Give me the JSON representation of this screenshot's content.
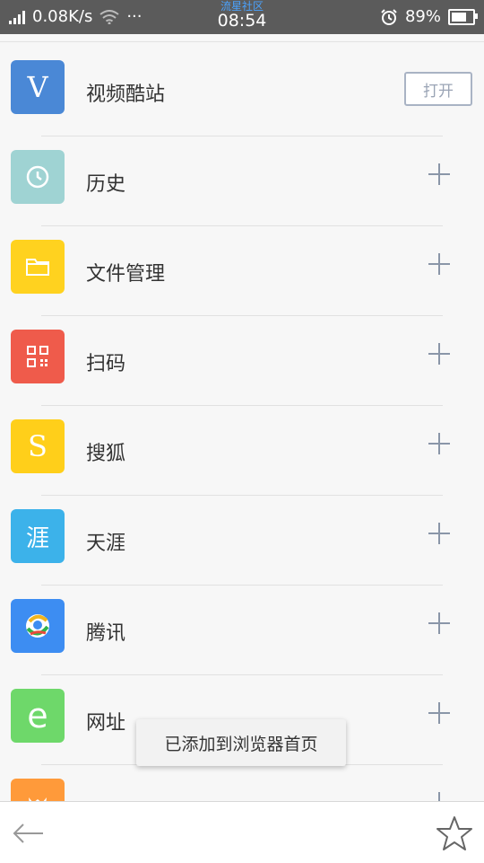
{
  "status_bar": {
    "net_speed": "0.08K/s",
    "more": "···",
    "carrier_label": "流星社区",
    "time": "08:54",
    "battery": "89%",
    "battery_level": 0.89
  },
  "items": [
    {
      "label": "视频酷站",
      "icon": "video-site-icon",
      "icon_text": "V",
      "color": "#4a88d6",
      "action": "打开"
    },
    {
      "label": "历史",
      "icon": "clock-icon",
      "color": "#9fd3d3"
    },
    {
      "label": "文件管理",
      "icon": "folder-icon",
      "color": "#ffd21f"
    },
    {
      "label": "扫码",
      "icon": "qr-code-icon",
      "color": "#ef5b4b"
    },
    {
      "label": "搜狐",
      "icon": "sohu-icon",
      "icon_text": "S",
      "color": "#ffcf1a"
    },
    {
      "label": "天涯",
      "icon": "tianya-icon",
      "icon_text": "涯",
      "color": "#3cb2ea"
    },
    {
      "label": "腾讯",
      "icon": "tencent-icon",
      "color": "#3d8df2"
    },
    {
      "label": "网址",
      "icon": "url-e-icon",
      "icon_text": "e",
      "color": "#6ed86a"
    },
    {
      "label": "",
      "icon": "partial-app-icon",
      "color": "#ff9a3a"
    }
  ],
  "toast": "已添加到浏览器首页",
  "bottom": {
    "back_icon": "back-arrow-icon",
    "star_icon": "star-outline-icon"
  }
}
